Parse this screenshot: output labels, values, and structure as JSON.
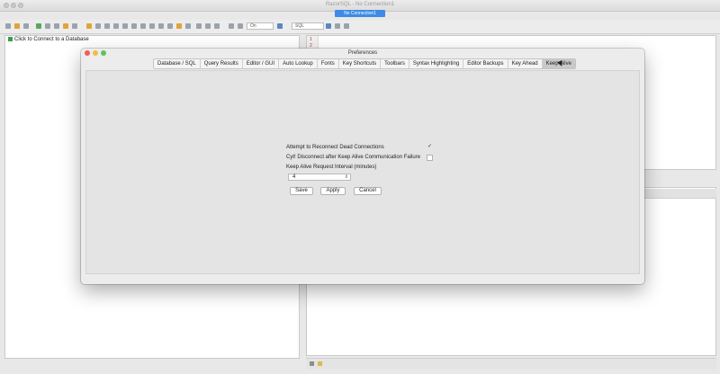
{
  "app": {
    "title": "RazorSQL - No Connection1",
    "badge": "No Connection1"
  },
  "toolbar": {
    "font_size": "On",
    "language": "SQL"
  },
  "left_panel": {
    "connect_label": "Click to Connect to a Database"
  },
  "editor": {
    "line_numbers": [
      "1",
      "2"
    ]
  },
  "dialog": {
    "title": "Preferences",
    "tabs": [
      "Database / SQL",
      "Query Results",
      "Editor / GUI",
      "Auto Lookup",
      "Fonts",
      "Key Shortcuts",
      "Toolbars",
      "Syntax Highlighting",
      "Editor Backups",
      "Key Ahead",
      "Keep Alive"
    ],
    "active_tab": "Keep Alive",
    "reconnect_label": "Attempt to Reconnect Dead Connections",
    "reconnect_checked": true,
    "disconnect_label": "Cyt! Disconnect after Keep Alive Communication Failure",
    "disconnect_checked": false,
    "interval_label": "Keep Alive Request Interval (minutes)",
    "interval_value": "4",
    "save_label": "Save",
    "apply_label": "Apply",
    "cancel_label": "Cancel"
  },
  "icons": {
    "check": "checkmark-icon",
    "spinner": "up-down-arrows-icon"
  }
}
